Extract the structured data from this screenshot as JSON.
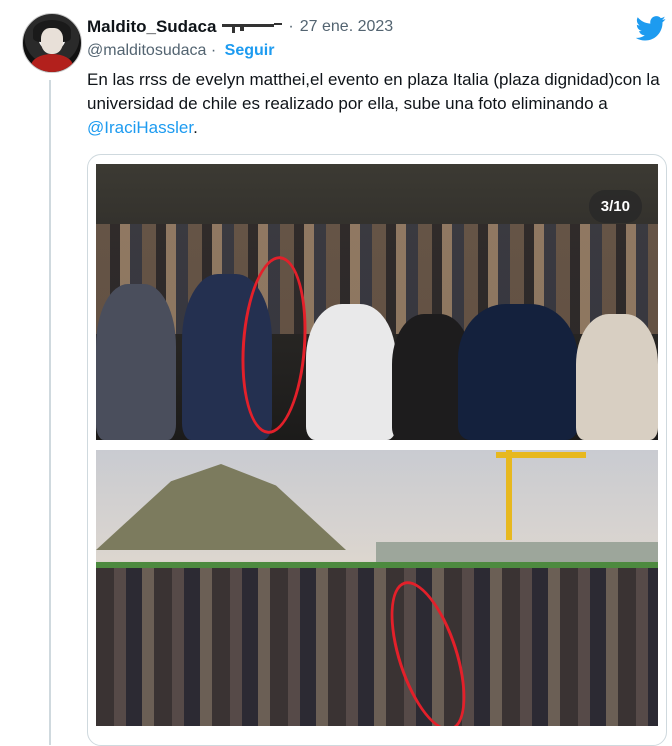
{
  "user": {
    "display_name": "Maldito_Sudaca",
    "handle": "@malditosudaca",
    "separator": "·",
    "follow_label": "Seguir",
    "date": "27 ene. 2023"
  },
  "tweet": {
    "text_before": "En las rrss de evelyn matthei,el evento en plaza Italia (plaza dignidad)con la universidad  de chile es realizado por ella, sube una foto eliminando a ",
    "mention": "@IraciHassler",
    "text_after": "."
  },
  "media": {
    "counter": "3/10"
  },
  "icons": {
    "brand": "twitter-bird-icon",
    "brand_color": "#1d9bf0",
    "highlight_color": "#e3202a"
  }
}
